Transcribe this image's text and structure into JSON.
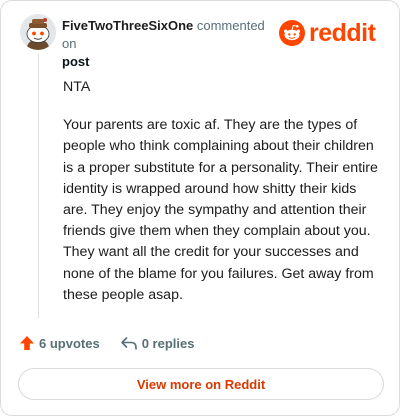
{
  "header": {
    "username": "FiveTwoThreeSixOne",
    "action_text": " commented on",
    "post_link": "post",
    "logo_text": "reddit"
  },
  "comment": {
    "paragraphs": [
      "NTA",
      "Your parents are toxic af. They are the types of people who think complaining about their children is a proper substitute for a personality. Their entire identity is wrapped around how shitty their kids are. They enjoy the sympathy and attention their friends give them when they complain about you. They want all the credit for your successes and none of the blame for you failures. Get away from these people asap."
    ]
  },
  "actions": {
    "upvotes": "6 upvotes",
    "replies": "0 replies"
  },
  "footer": {
    "view_more": "View more on Reddit"
  },
  "colors": {
    "brand": "#ff4500",
    "link": "#d93a00",
    "muted": "#576f76"
  },
  "icons": {
    "upvote": "arrow-up-icon",
    "reply": "reply-arrow-icon",
    "logo": "snoo-icon"
  }
}
